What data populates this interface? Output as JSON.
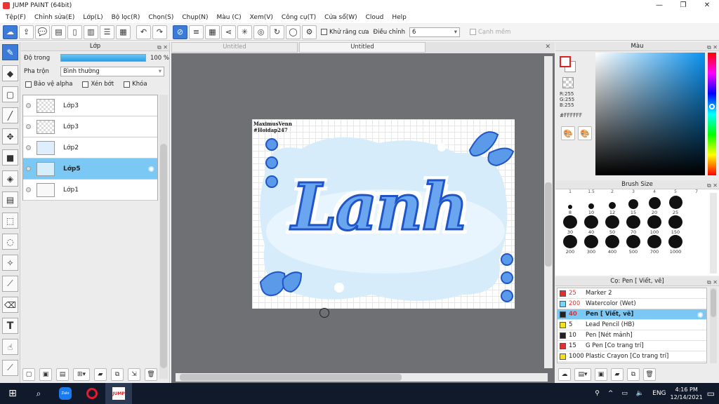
{
  "app": {
    "title": "JUMP PAINT (64bit)"
  },
  "window_controls": {
    "minimize": "—",
    "maximize": "❐",
    "close": "✕"
  },
  "menu": [
    "Tệp(F)",
    "Chỉnh sửa(E)",
    "Lớp(L)",
    "Bộ lọc(R)",
    "Chọn(S)",
    "Chụp(N)",
    "Màu (C)",
    "Xem(V)",
    "Công cụ(T)",
    "Cửa sổ(W)",
    "Cloud",
    "Help"
  ],
  "toolbar": {
    "antialias_label": "Khử răng cưa",
    "adjust_label": "Điều chỉnh",
    "adjust_value": "6",
    "smooth_label": "Cạnh mềm"
  },
  "layer_panel": {
    "title": "Lớp",
    "opacity_label": "Độ trong",
    "opacity_value": "100 %",
    "blend_label": "Pha trộn",
    "blend_value": "Bình thường",
    "protect_alpha": "Bảo vệ alpha",
    "clipping": "Xén bớt",
    "lock": "Khóa",
    "layers": [
      {
        "name": "Lớp3"
      },
      {
        "name": "Lớp3"
      },
      {
        "name": "Lớp2"
      },
      {
        "name": "Lớp5"
      },
      {
        "name": "Lớp1"
      }
    ]
  },
  "canvas": {
    "tabs": [
      "Untitled",
      "Untitled"
    ],
    "artwork": {
      "credit_line1": "MaximusVenn",
      "credit_line2": "#Hoidap247",
      "lettering": "Lanh"
    }
  },
  "color_panel": {
    "title": "Màu",
    "r": "R:255",
    "g": "G:255",
    "b": "B:255",
    "hex": "#FFFFFF",
    "accent": "#0a92f0"
  },
  "brush_size": {
    "title": "Brush Size",
    "top_row_partial": [
      "1",
      "1.5",
      "2",
      "3",
      "4",
      "5",
      "7"
    ],
    "sizes": [
      "8",
      "10",
      "12",
      "15",
      "20",
      "25",
      "30",
      "40",
      "50",
      "70",
      "100",
      "150",
      "200",
      "300",
      "400",
      "500",
      "700",
      "1000"
    ]
  },
  "tool_panel": {
    "title": "Cọ: Pen [ Viết, vẽ]",
    "items": [
      {
        "size": "25",
        "name": "Marker 2",
        "color": "#e03030"
      },
      {
        "size": "200",
        "name": "Watercolor (Wet)",
        "color": "#7ad4f5"
      },
      {
        "size": "40",
        "name": "Pen [ Viết, vẽ]",
        "color": "#222222"
      },
      {
        "size": "5",
        "name": "Lead Pencil (HB)",
        "color": "#f0e020"
      },
      {
        "size": "10",
        "name": "Pen [Nét mảnh]",
        "color": "#222222"
      },
      {
        "size": "15",
        "name": "G Pen [Co trang trí]",
        "color": "#e03030"
      },
      {
        "size": "1000",
        "name": "Plastic Crayon [Co trang trí]",
        "color": "#f0e020"
      }
    ]
  },
  "taskbar": {
    "zalo": "Zalo",
    "jp": "JUMP",
    "lang": "ENG",
    "time": "4:16 PM",
    "date": "12/14/2021"
  }
}
